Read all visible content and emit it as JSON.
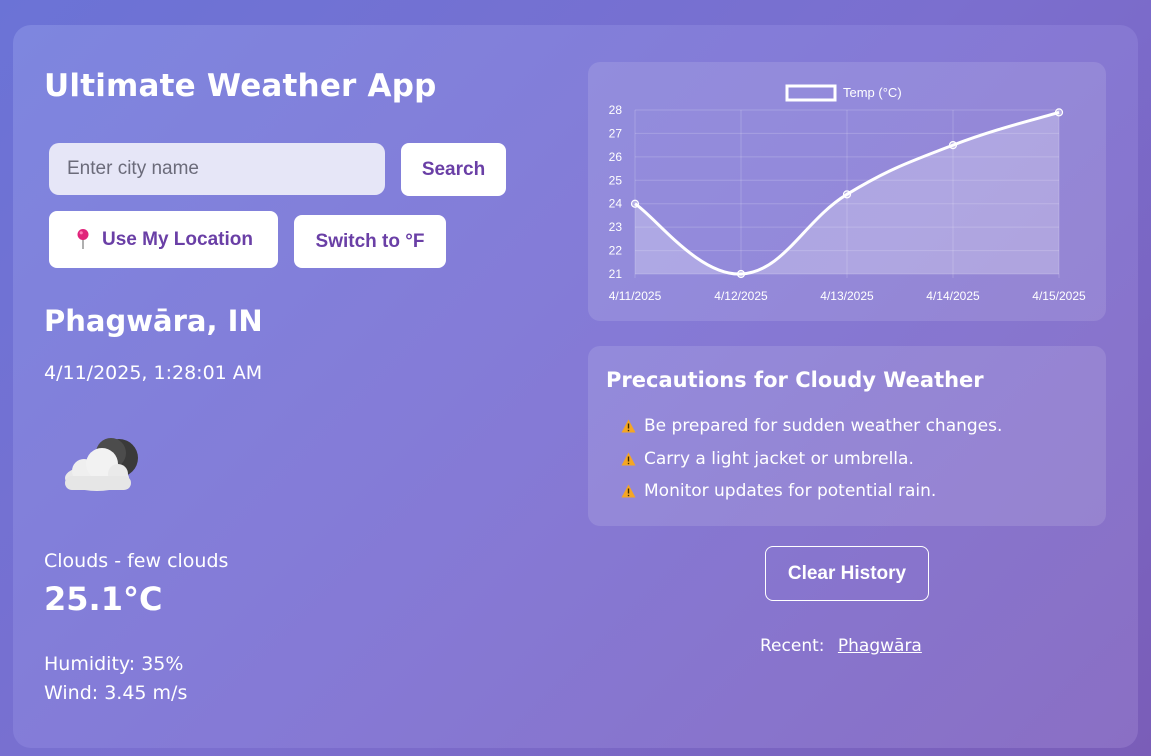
{
  "app": {
    "title": "Ultimate Weather App"
  },
  "search": {
    "placeholder": "Enter city name",
    "value": "",
    "button_label": "Search"
  },
  "buttons": {
    "location_label": "Use My Location",
    "unit_label": "Switch to °F",
    "clear_history_label": "Clear History"
  },
  "weather": {
    "city": "Phagwāra, IN",
    "datetime": "4/11/2025, 1:28:01 AM",
    "icon": "cloud-moon-icon",
    "description": "Clouds - few clouds",
    "temperature": "25.1°C",
    "humidity": "Humidity: 35%",
    "wind": "Wind: 3.45 m/s"
  },
  "precautions": {
    "title": "Precautions for Cloudy Weather",
    "items": [
      "Be prepared for sudden weather changes.",
      "Carry a light jacket or umbrella.",
      "Monitor updates for potential rain."
    ]
  },
  "recent": {
    "label": "Recent:",
    "items": [
      "Phagwāra"
    ]
  },
  "chart_data": {
    "type": "line",
    "x": [
      "4/11/2025",
      "4/12/2025",
      "4/13/2025",
      "4/14/2025",
      "4/15/2025"
    ],
    "series": [
      {
        "name": "Temp (°C)",
        "values": [
          24.0,
          21.0,
          24.4,
          26.5,
          27.9
        ]
      }
    ],
    "ylim": [
      21,
      28
    ],
    "yticks": [
      21,
      22,
      23,
      24,
      25,
      26,
      27,
      28
    ],
    "grid": true,
    "legend": "top-center",
    "colors": {
      "line": "#ffffff",
      "fill": "rgba(255,255,255,0.25)"
    }
  }
}
